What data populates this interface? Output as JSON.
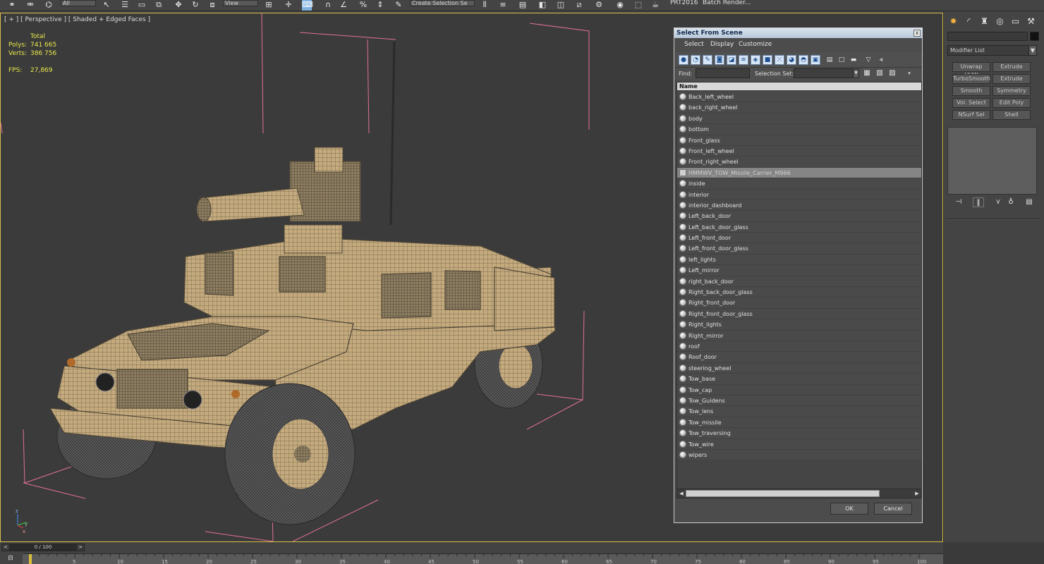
{
  "toolbar": {
    "filter_value": "All",
    "view_value": "View",
    "selection_set_placeholder": "Create Selection Se",
    "prt_label": "PRT2016",
    "batch_render_label": "Batch Render..."
  },
  "viewport": {
    "label": "[ + ] [ Perspective ] [ Shaded + Edged Faces ]",
    "stats": {
      "total_label": "Total",
      "polys_label": "Polys:",
      "polys_value": "741 665",
      "verts_label": "Verts:",
      "verts_value": "386 756",
      "fps_label": "FPS:",
      "fps_value": "27,869"
    },
    "axis": {
      "z": "z",
      "y": "y",
      "x": "x"
    }
  },
  "command_panel": {
    "modifier_list": "Modifier List",
    "modifier_buttons": [
      "Unwrap UVW",
      "Extrude",
      "TurboSmooth",
      "Extrude",
      "Smooth",
      "Symmetry",
      "Vol. Select",
      "Edit Poly",
      "NSurf Sel",
      "Shell"
    ]
  },
  "dialog": {
    "title": "Select From Scene",
    "close": "x",
    "menu": [
      "Select",
      "Display",
      "Customize"
    ],
    "find_label": "Find:",
    "find_value": "",
    "selection_set_label": "Selection Set:",
    "column_header": "Name",
    "objects": [
      "Back_left_wheel",
      "back_right_wheel",
      "body",
      "bottom",
      "Front_glass",
      "Front_left_wheel",
      "Front_right_wheel",
      "HMMWV_TOW_Missile_Carrier_M966",
      "inside",
      "interior",
      "interior_dashboard",
      "Left_back_door",
      "Left_back_door_glass",
      "Left_front_door",
      "Left_front_door_glass",
      "left_lights",
      "Left_mirror",
      "right_back_door",
      "Right_back_door_glass",
      "Right_front_door",
      "Right_front_door_glass",
      "Right_lights",
      "Right_mirror",
      "roof",
      "Roof_door",
      "steering_wheel",
      "Tow_base",
      "Tow_cap",
      "Tow_Guidens",
      "Tow_lens",
      "Tow_missile",
      "Tow_traversing",
      "Tow_wire",
      "wipers"
    ],
    "selected_object": "HMMWV_TOW_Missile_Carrier_M966",
    "ok_label": "OK",
    "cancel_label": "Cancel"
  },
  "timeline": {
    "frame_display": "0 / 100",
    "current_frame": 0,
    "tick_labels": [
      "5",
      "10",
      "15",
      "20",
      "25",
      "30",
      "35",
      "40",
      "45",
      "50",
      "55",
      "60",
      "65",
      "70",
      "75",
      "80",
      "85",
      "90",
      "95",
      "100"
    ]
  },
  "colors": {
    "viewport_bg": "#3b3b3b",
    "stats_text": "#e8e84c",
    "active_border": "#d8bf4a",
    "model_fill": "#c4aa7d",
    "wire": "#555555",
    "bbox": "#e0709a"
  }
}
